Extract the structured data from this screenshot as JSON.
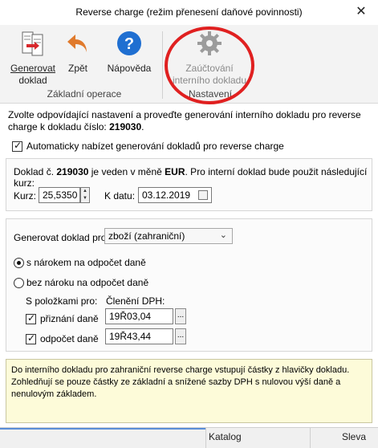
{
  "window": {
    "title": "Reverse charge (režim přenesení daňové povinnosti)",
    "close_glyph": "✕"
  },
  "ribbon": {
    "buttons": [
      {
        "name": "generate-document",
        "label_line1": "Generovat",
        "label_line2": "doklad",
        "icon": "generate-document-icon"
      },
      {
        "name": "back",
        "label_line1": "Zpět",
        "icon": "back-arrow-icon"
      },
      {
        "name": "help",
        "label_line1": "Nápověda",
        "icon": "help-icon"
      },
      {
        "name": "posting-settings",
        "label_line1": "Zaúčtování",
        "label_line2": "interního dokladu",
        "icon": "gear-icon",
        "disabled": true
      }
    ],
    "groups": [
      "Základní operace",
      "Nastavení"
    ]
  },
  "intro": {
    "text": "Zvolte odpovídající nastavení a proveďte generování interního dokladu pro reverse charge k dokladu číslo:",
    "doc_number": "219030",
    "suffix": "."
  },
  "auto_offer": {
    "label": "Automaticky nabízet generování dokladů pro reverse charge",
    "checked": true
  },
  "rate_panel": {
    "prefix": "Doklad č.",
    "doc_number": "219030",
    "mid": "je veden v měně",
    "currency": "EUR",
    "suffix": ". Pro interní doklad bude použit následující kurz:",
    "rate_label": "Kurz:",
    "rate_value": "25,5350",
    "date_label": "K datu:",
    "date_value": "03.12.2019"
  },
  "gen_panel": {
    "doc_type_label": "Generovat doklad pro:",
    "doc_type_value": "zboží (zahraniční)",
    "radio_with": "s nárokem na odpočet daně",
    "radio_without": "bez nároku na odpočet daně",
    "items_label": "S položkami pro:",
    "vat_label": "Členění DPH:",
    "rows": [
      {
        "label": "přiznání daně",
        "value": "19Ř03,04",
        "checked": true
      },
      {
        "label": "odpočet daně",
        "value": "19Ř43,44",
        "checked": true
      }
    ],
    "ellipsis": "..."
  },
  "info": {
    "text": "Do interního dokladu pro zahraniční reverse charge vstupují částky z hlavičky dokladu. Zohledňují se pouze částky ze základní a snížené sazby DPH s nulovou výší daně a nenulovým základem."
  },
  "bg_grid": {
    "col1": "Katalog",
    "col2": "Sleva"
  },
  "colors": {
    "highlight": "#e02020",
    "help_blue": "#1f6fd1",
    "back_orange": "#e07a2c",
    "info_bg": "#fdfbd9"
  }
}
